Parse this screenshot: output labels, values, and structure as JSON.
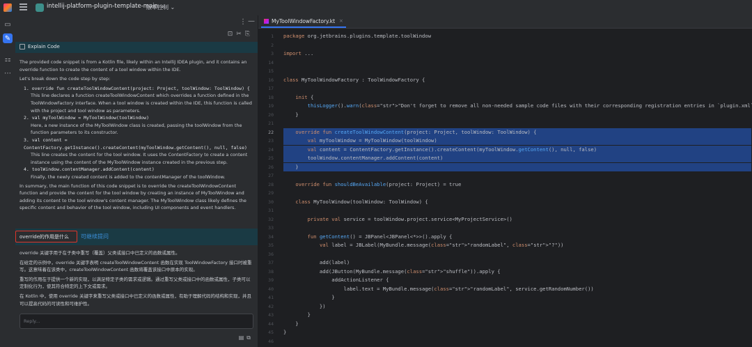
{
  "titlebar": {
    "project": "intellij-platform-plugin-template-main",
    "vcs": "版本控制"
  },
  "explain": {
    "title": "Explain Code",
    "intro": "The provided code snippet is from a Kotlin file, likely within an IntelliJ IDEA plugin, and it contains an override function to create the content of a tool window within the IDE.",
    "lead": "Let's break down the code step by step:",
    "steps": [
      {
        "head": "1. override fun createToolWindowContent(project: Project, toolWindow: ToolWindow) {",
        "body": "This line declares a function createToolWindowContent which overrides a function defined in the ToolWindowFactory interface. When a tool window is created within the IDE, this function is called with the project and tool window as parameters."
      },
      {
        "head": "2. val myToolWindow = MyToolWindow(toolWindow)",
        "body": "Here, a new instance of the MyToolWindow class is created, passing the toolWindow from the function parameters to its constructor."
      },
      {
        "head": "3. val content = ContentFactory.getInstance().createContent(myToolWindow.getContent(), null, false)",
        "body": "This line creates the content for the tool window. It uses the ContentFactory to create a content instance using the content of the MyToolWindow instance created in the previous step."
      },
      {
        "head": "4. toolWindow.contentManager.addContent(content)",
        "body": "Finally, the newly created content is added to the contentManager of the toolWindow."
      }
    ],
    "summary": "In summary, the main function of this code snippet is to override the createToolWindowContent function and provide the content for the tool window by creating an instance of MyToolWindow and adding its content to the tool window's content manager. The MyToolWindow class likely defines the specific content and behavior of the tool window, including UI components and event handlers."
  },
  "question": {
    "text": "override的作用是什么",
    "follow": "可继续提问"
  },
  "answer2": {
    "p1": "override 关键字用于在子类中重写（覆盖）父类或接口中已定义的函数或属性。",
    "p2": "在给定的示例中，override 关键字表明 createToolWindowContent 函数在实现 ToolWindowFactory 接口时被重写。这意味着在该类中，createToolWindowContent 函数将覆盖该接口中原本的实现。",
    "p3": "重写的作用在于提供一个新的实现，以满足特定子类的需求或逻辑。通过重写父类或接口中的函数或属性，子类可以定制化行为，使其符合特定的上下文或需求。",
    "p4": "在 Kotlin 中，使用 override 关键字来重写父类或接口中已定义的函数或属性，有助于理解代码的结构和实现，并且可以提高代码的可读性和可维护性。"
  },
  "reply": {
    "placeholder": "Reply..."
  },
  "editor": {
    "tab": "MyToolWindowFactory.kt",
    "lines": [
      {
        "n": "1",
        "t": "package org.jetbrains.plugins.template.toolWindow"
      },
      {
        "n": "2",
        "t": ""
      },
      {
        "n": "3",
        "t": "import ..."
      },
      {
        "n": "14",
        "t": ""
      },
      {
        "n": "15",
        "t": ""
      },
      {
        "n": "16",
        "t": "class MyToolWindowFactory : ToolWindowFactory {"
      },
      {
        "n": "17",
        "t": ""
      },
      {
        "n": "18",
        "t": "    init {"
      },
      {
        "n": "19",
        "t": "        thisLogger().warn(\"Don't forget to remove all non-needed sample code files with their corresponding registration entries in `plugin.xml`.\")"
      },
      {
        "n": "20",
        "t": "    }"
      },
      {
        "n": "21",
        "t": ""
      },
      {
        "n": "22",
        "t": "    override fun createToolWindowContent(project: Project, toolWindow: ToolWindow) {"
      },
      {
        "n": "23",
        "t": "        val myToolWindow = MyToolWindow(toolWindow)"
      },
      {
        "n": "24",
        "t": "        val content = ContentFactory.getInstance().createContent(myToolWindow.getContent(), null, false)"
      },
      {
        "n": "25",
        "t": "        toolWindow.contentManager.addContent(content)"
      },
      {
        "n": "26",
        "t": "    }"
      },
      {
        "n": "27",
        "t": ""
      },
      {
        "n": "28",
        "t": "    override fun shouldBeAvailable(project: Project) = true"
      },
      {
        "n": "29",
        "t": ""
      },
      {
        "n": "30",
        "t": "    class MyToolWindow(toolWindow: ToolWindow) {"
      },
      {
        "n": "31",
        "t": ""
      },
      {
        "n": "32",
        "t": "        private val service = toolWindow.project.service<MyProjectService>()"
      },
      {
        "n": "33",
        "t": ""
      },
      {
        "n": "34",
        "t": "        fun getContent() = JBPanel<JBPanel<*>>().apply {"
      },
      {
        "n": "35",
        "t": "            val label = JBLabel(MyBundle.message(\"randomLabel\", \"?\"))"
      },
      {
        "n": "36",
        "t": ""
      },
      {
        "n": "37",
        "t": "            add(label)"
      },
      {
        "n": "38",
        "t": "            add(JButton(MyBundle.message(\"shuffle\")).apply {"
      },
      {
        "n": "39",
        "t": "                addActionListener {"
      },
      {
        "n": "40",
        "t": "                    label.text = MyBundle.message(\"randomLabel\", service.getRandomNumber())"
      },
      {
        "n": "41",
        "t": "                }"
      },
      {
        "n": "42",
        "t": "            })"
      },
      {
        "n": "43",
        "t": "        }"
      },
      {
        "n": "44",
        "t": "    }"
      },
      {
        "n": "45",
        "t": "}"
      },
      {
        "n": "46",
        "t": ""
      }
    ]
  }
}
